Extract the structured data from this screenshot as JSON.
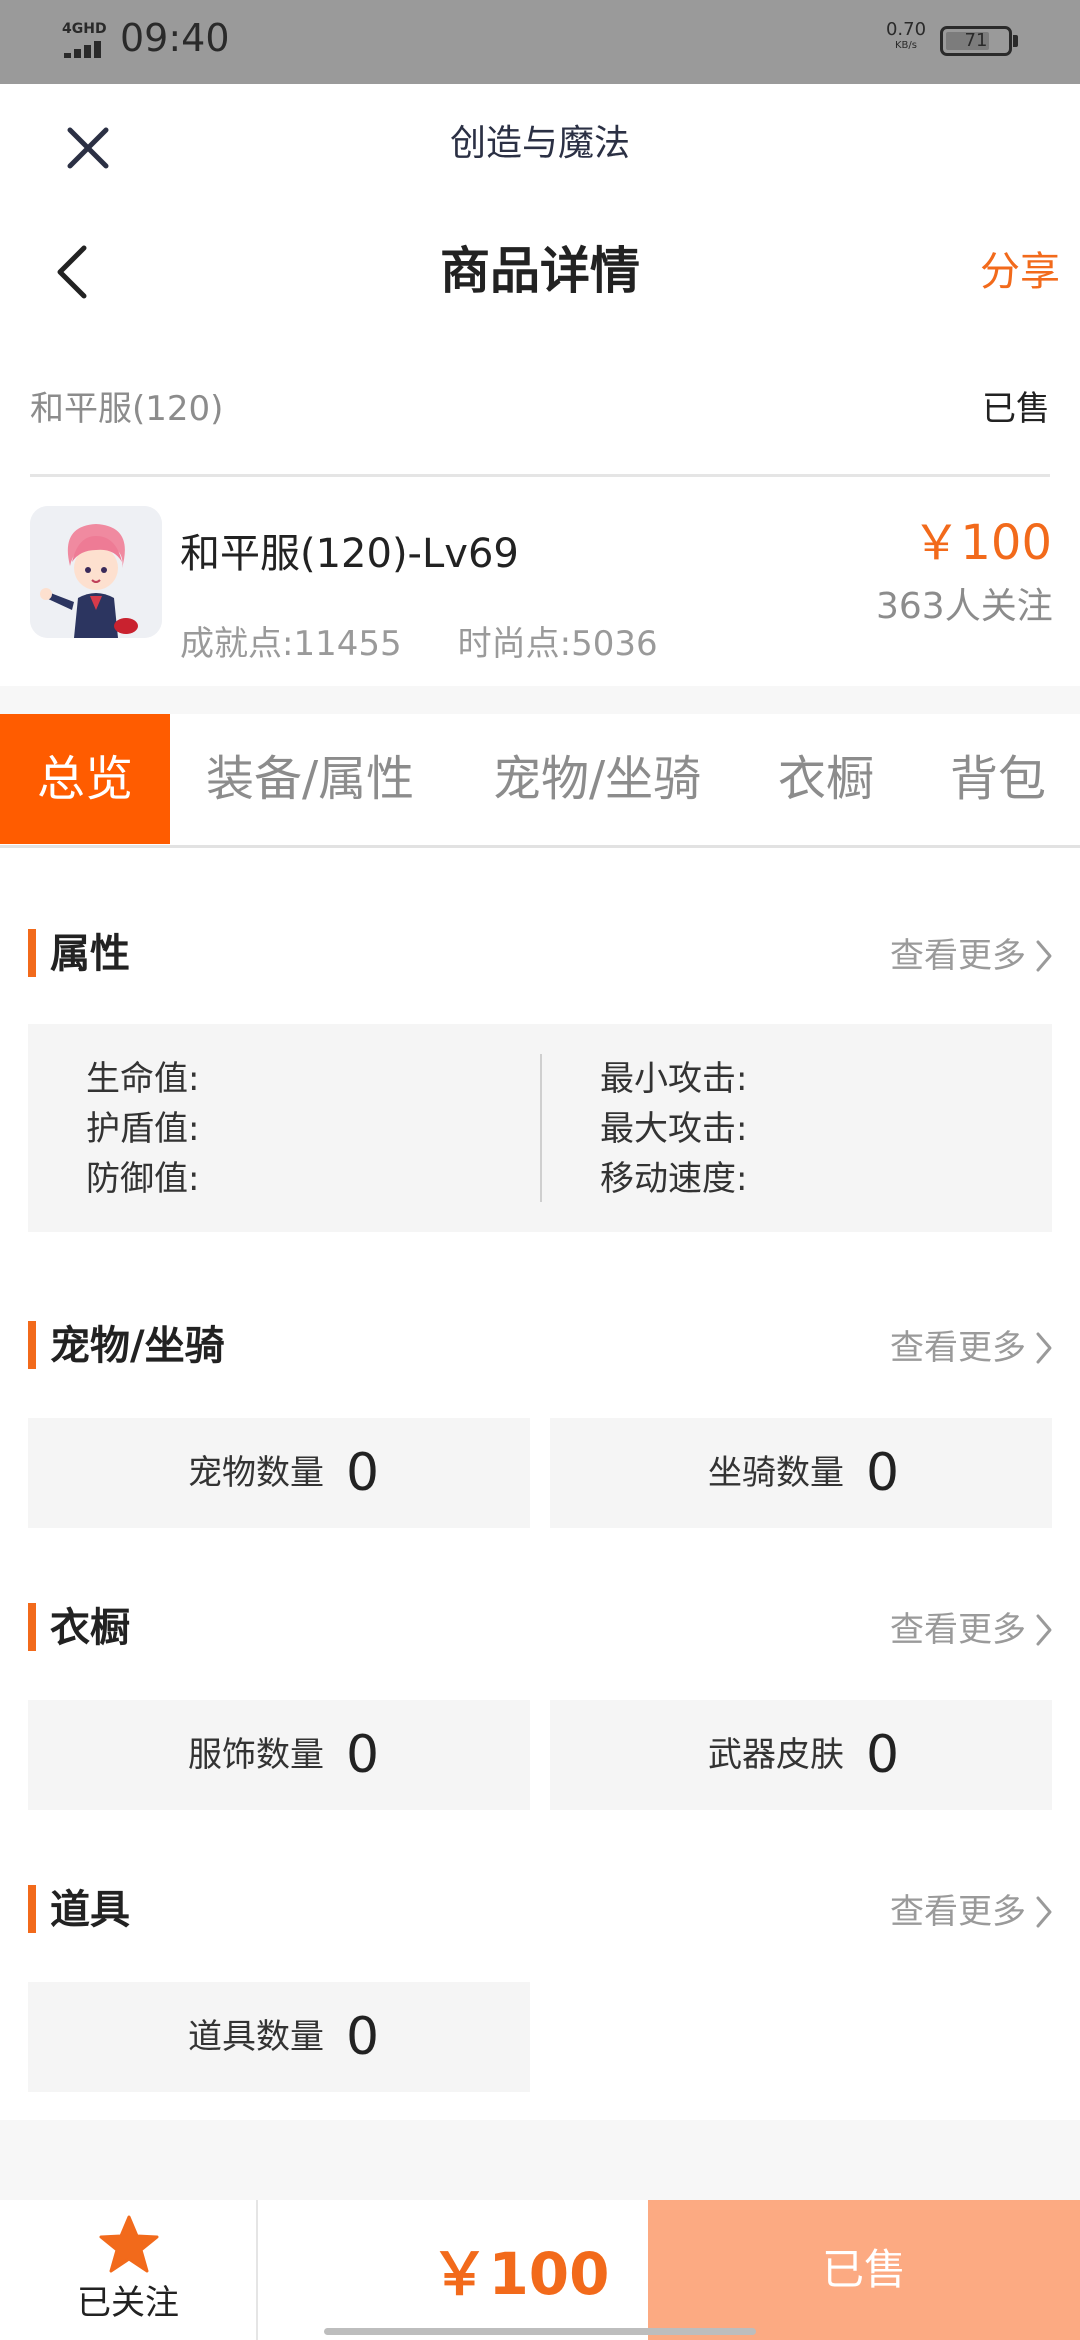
{
  "status_bar": {
    "network": "4GHD",
    "time": "09:40",
    "speed_value": "0.70",
    "speed_unit": "KB/s",
    "battery": "71",
    "battery_level": 0.71
  },
  "top_bar": {
    "title": "创造与魔法"
  },
  "nav": {
    "title": "商品详情",
    "share_label": "分享"
  },
  "product": {
    "sub_name": "和平服(120)",
    "status": "已售",
    "title": "和平服(120)-Lv69",
    "achievement": "成就点:11455",
    "fashion": "时尚点:5036",
    "price": "￥100",
    "followers": "363人关注"
  },
  "tabs": [
    {
      "label": "总览",
      "active": true
    },
    {
      "label": "装备/属性",
      "active": false
    },
    {
      "label": "宠物/坐骑",
      "active": false
    },
    {
      "label": "衣橱",
      "active": false
    },
    {
      "label": "背包",
      "active": false
    }
  ],
  "sections": {
    "attributes": {
      "title": "属性",
      "more": "查看更多",
      "left_labels": [
        "生命值:",
        "护盾值:",
        "防御值:"
      ],
      "right_labels": [
        "最小攻击:",
        "最大攻击:",
        "移动速度:"
      ]
    },
    "pets": {
      "title": "宠物/坐骑",
      "more": "查看更多",
      "items": [
        {
          "label": "宠物数量",
          "value": "0"
        },
        {
          "label": "坐骑数量",
          "value": "0"
        }
      ]
    },
    "wardrobe": {
      "title": "衣橱",
      "more": "查看更多",
      "items": [
        {
          "label": "服饰数量",
          "value": "0"
        },
        {
          "label": "武器皮肤",
          "value": "0"
        }
      ]
    },
    "items": {
      "title": "道具",
      "more": "查看更多",
      "items": [
        {
          "label": "道具数量",
          "value": "0"
        }
      ]
    }
  },
  "bottom": {
    "follow_label": "已关注",
    "price": "￥100",
    "sold_label": "已售"
  },
  "colors": {
    "accent": "#f26a1b",
    "active_tab": "#ff5c00",
    "sold_button": "#fcaa82"
  }
}
